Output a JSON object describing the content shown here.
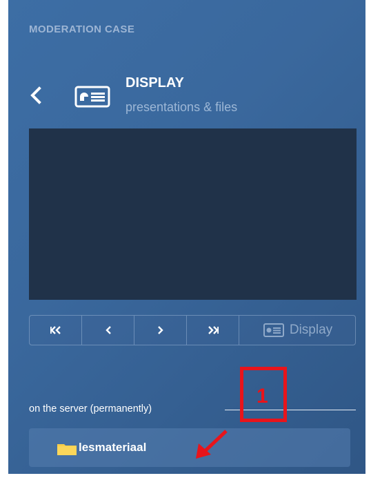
{
  "header": {
    "section_label": "MODERATION CASE",
    "title": "DISPLAY",
    "subtitle": "presentations & files"
  },
  "controls": {
    "first_icon": "double-chevron-left-icon",
    "prev_icon": "chevron-left-icon",
    "next_icon": "chevron-right-icon",
    "last_icon": "double-chevron-right-icon",
    "display_label": "Display"
  },
  "files": {
    "section_label": "on the server (permanently)",
    "items": [
      {
        "name": "lesmateriaal",
        "icon": "folder-icon"
      }
    ]
  },
  "annotation": {
    "marker_number": "1"
  },
  "colors": {
    "panel_bg": "#3a689d",
    "preview_bg": "#203249",
    "folder_yellow": "#f7cd4a",
    "annotation_red": "#e8141b"
  }
}
